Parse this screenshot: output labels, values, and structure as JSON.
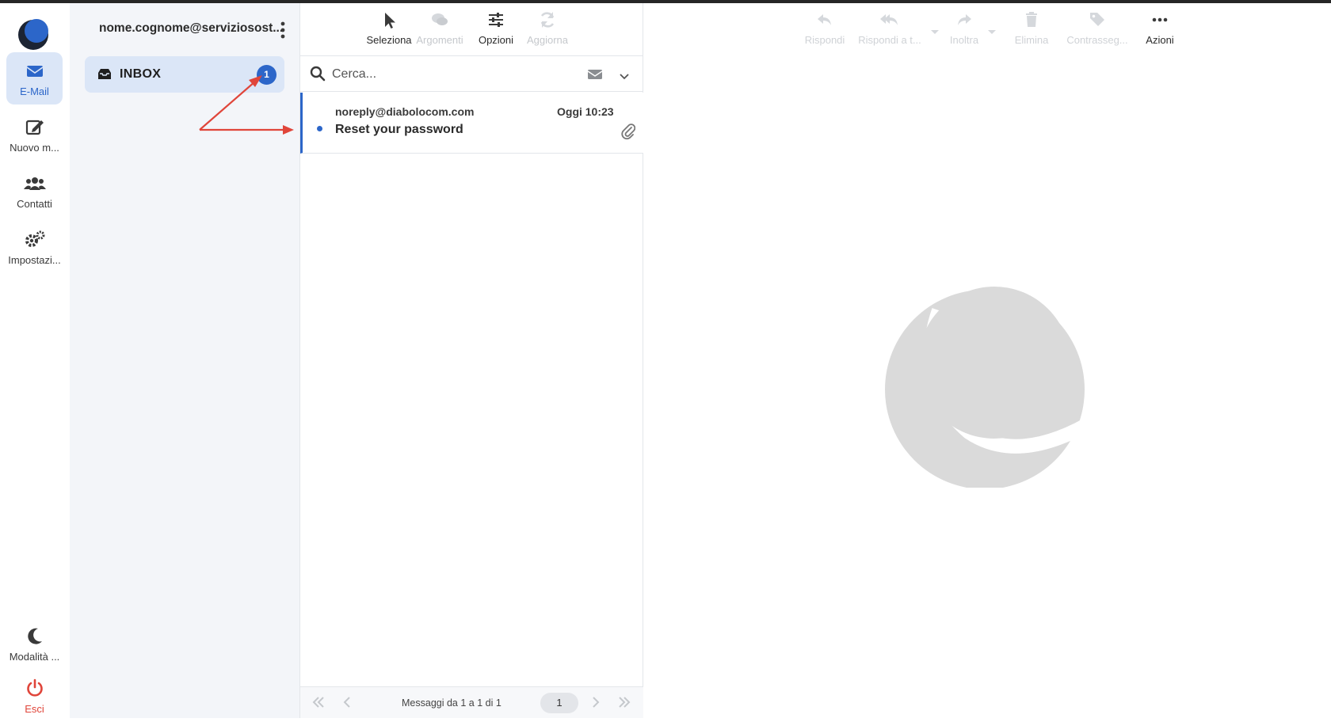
{
  "nav": {
    "items": [
      {
        "label": "E-Mail",
        "icon": "envelope-icon",
        "active": true
      },
      {
        "label": "Nuovo m...",
        "icon": "compose-icon"
      },
      {
        "label": "Contatti",
        "icon": "contacts-icon"
      },
      {
        "label": "Impostazi...",
        "icon": "settings-icon"
      }
    ],
    "mode_label": "Modalità ...",
    "exit_label": "Esci"
  },
  "folders": {
    "account": "nome.cognome@serviziosost...",
    "inbox": {
      "label": "INBOX",
      "unread": "1"
    }
  },
  "list_toolbar": {
    "select": "Seleziona",
    "threads": "Argomenti",
    "options": "Opzioni",
    "refresh": "Aggiorna"
  },
  "search": {
    "placeholder": "Cerca..."
  },
  "messages": [
    {
      "from": "noreply@diabolocom.com",
      "date": "Oggi 10:23",
      "subject": "Reset your password",
      "unread": true,
      "attachment": true
    }
  ],
  "pager": {
    "info": "Messaggi da 1 a 1 di 1",
    "page": "1"
  },
  "reader_toolbar": {
    "reply": "Rispondi",
    "reply_all": "Rispondi a t...",
    "forward": "Inoltra",
    "delete": "Elimina",
    "flag": "Contrasseg...",
    "actions": "Azioni"
  },
  "colors": {
    "accent": "#2c66c9",
    "active_bg": "#dbe6f7",
    "exit": "#e0453a",
    "annotation": "#e0453a"
  }
}
